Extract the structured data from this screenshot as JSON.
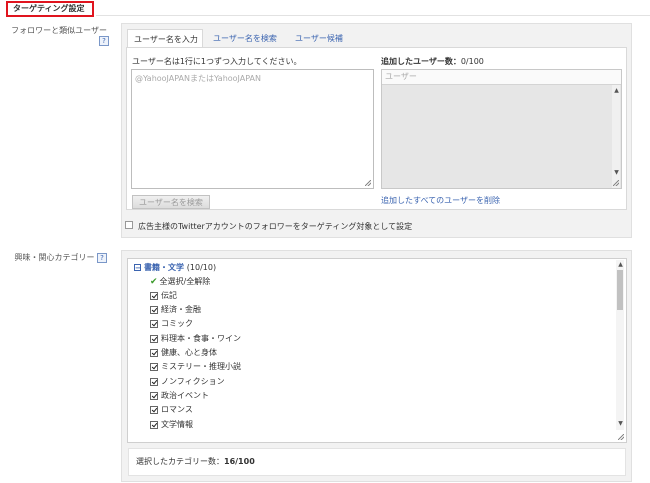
{
  "section": {
    "title": "ターゲティング設定"
  },
  "follower": {
    "label": "フォロワーと類似ユーザー",
    "help": "?",
    "tabs": [
      {
        "label": "ユーザー名を入力",
        "active": true
      },
      {
        "label": "ユーザー名を検索",
        "active": false
      },
      {
        "label": "ユーザー候補",
        "active": false
      }
    ],
    "input_instruction": "ユーザー名は1行に1つずつ入力してください。",
    "input_placeholder": "@YahooJAPANまたはYahooJAPAN",
    "added_users_label": "追加したユーザー数：",
    "added_users_count": "0/100",
    "user_list_header": "ユーザー",
    "search_button": "ユーザー名を検索",
    "remove_all_link": "追加したすべてのユーザーを削除",
    "advertiser_followers_checkbox": "広告主様のTwitterアカウントのフォロワーをターゲティング対象として設定"
  },
  "interests": {
    "label": "興味・関心カテゴリー",
    "help": "?",
    "group": {
      "name": "書籍・文学",
      "count": "(10/10)",
      "select_all": "全選択/全解除",
      "items": [
        "伝記",
        "経済・金融",
        "コミック",
        "料理本・食事・ワイン",
        "健康、心と身体",
        "ミステリー・推理小説",
        "ノンフィクション",
        "政治イベント",
        "ロマンス",
        "文学情報"
      ]
    },
    "selected_label": "選択したカテゴリー数：",
    "selected_count": "16/100"
  }
}
